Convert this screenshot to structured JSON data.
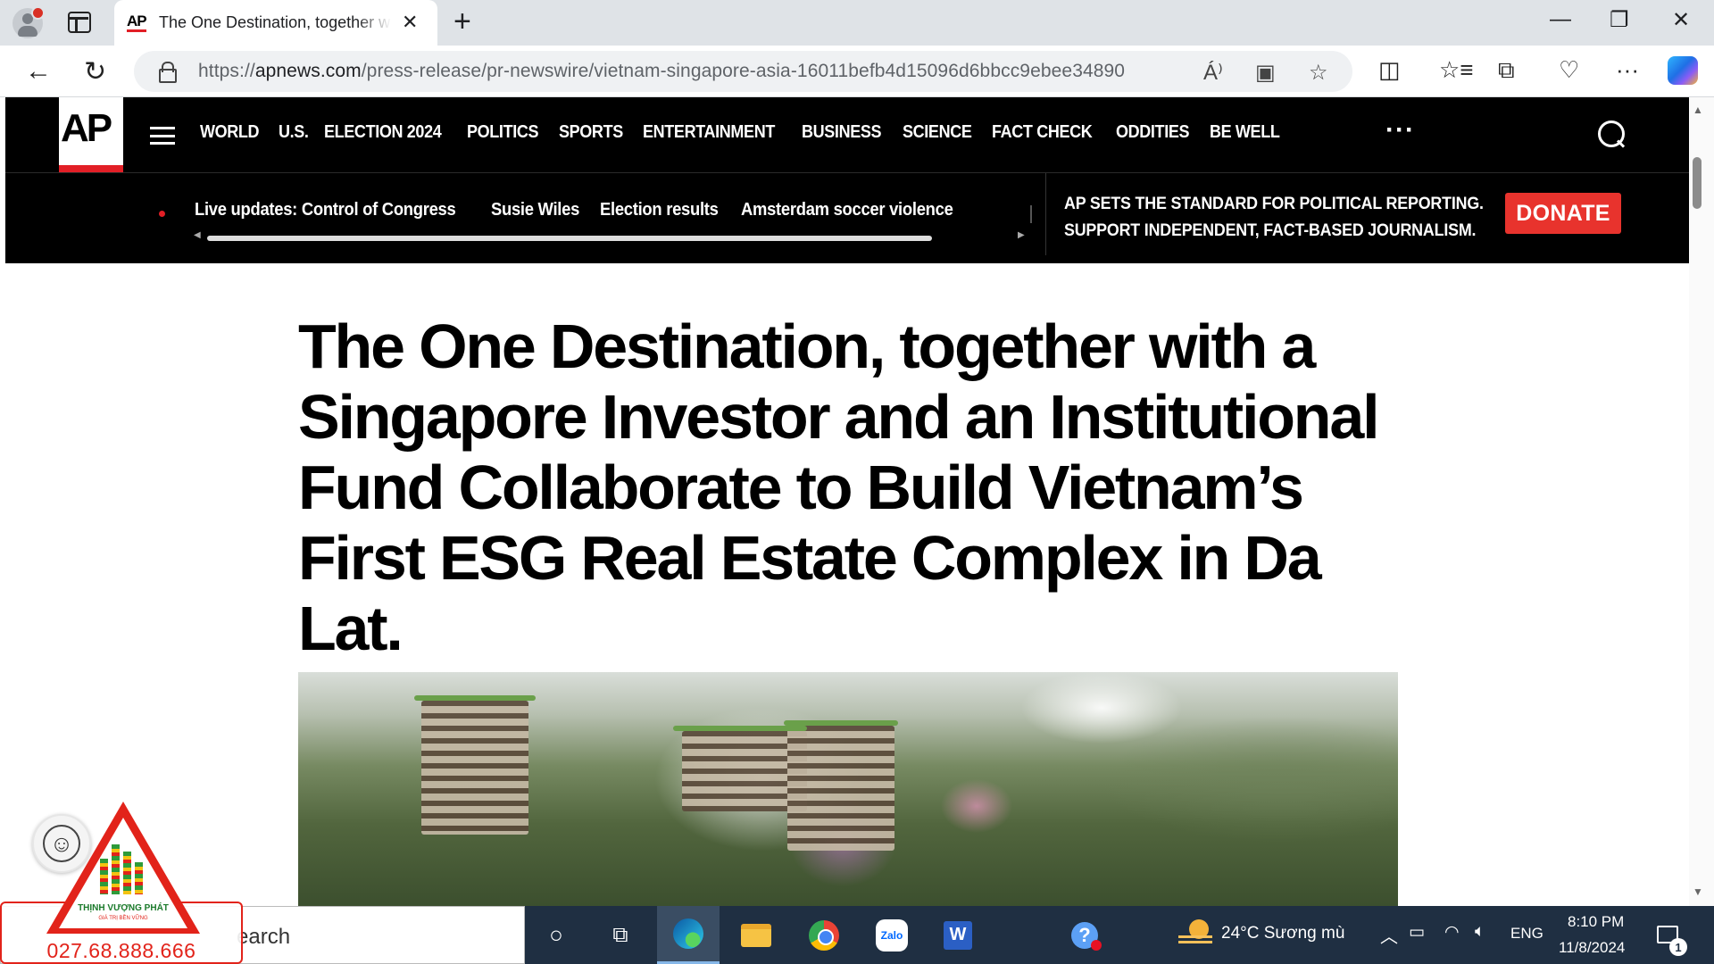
{
  "browser": {
    "tab": {
      "favicon": "AP",
      "title": "The One Destination, together with a Singapore Investor and an Institutional Fund Collaborate to Build Vietnam’s First ESG Real Estate Complex in Da Lat.",
      "close": "✕"
    },
    "new_tab": "+",
    "window": {
      "minimize": "—",
      "restore": "❐",
      "close": "✕"
    },
    "nav": {
      "back": "←",
      "refresh": "↻"
    },
    "url": {
      "prefix": "https://",
      "domain": "apnews.com",
      "path": "/press-release/pr-newswire/vietnam-singapore-asia-16011befb4d15096d6bbcc9ebee34890"
    },
    "icons": {
      "read_aloud": "Á⁾",
      "immersive_reader": "▣",
      "favorite": "☆",
      "split_screen": "◫",
      "favorites": "☆≡",
      "collections": "⧉",
      "browser_essentials": "♡",
      "more": "···"
    }
  },
  "ap": {
    "logo": "AP",
    "nav": [
      "WORLD",
      "U.S.",
      "ELECTION 2024",
      "POLITICS",
      "SPORTS",
      "ENTERTAINMENT",
      "BUSINESS",
      "SCIENCE",
      "FACT CHECK",
      "ODDITIES",
      "BE WELL"
    ],
    "more": "···",
    "trending": [
      "Live updates: Control of Congress",
      "Susie Wiles",
      "Election results",
      "Amsterdam soccer violence"
    ],
    "promo_line1": "AP SETS THE STANDARD FOR POLITICAL REPORTING.",
    "promo_line2": "SUPPORT INDEPENDENT, FACT-BASED JOURNALISM.",
    "donate": "DONATE"
  },
  "article": {
    "headline": "The One Destination, together with a Singapore Investor and an Institutional Fund Collaborate to Build Vietnam’s First ESG Real Estate Complex in Da Lat."
  },
  "taskbar": {
    "search_placeholder": "earch",
    "weather": "24°C  Sương mù",
    "language": "ENG",
    "time": "8:10 PM",
    "date": "11/8/2024",
    "notifications": "1",
    "zalo": "Zalo",
    "word": "W",
    "help": "?"
  },
  "watermark": {
    "name": "THỊNH VƯỢNG PHÁT",
    "slogan": "GIÁ TRỊ BỀN VỮNG",
    "phone": "027.68.888.666"
  }
}
